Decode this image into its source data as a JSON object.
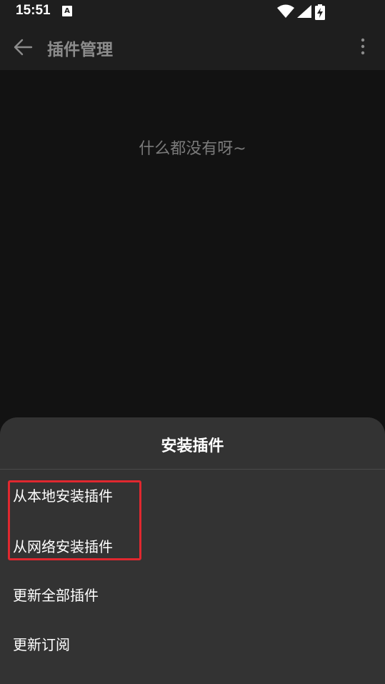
{
  "status_bar": {
    "time": "15:51",
    "notification_icon_letter": "A",
    "icons": [
      "wifi-icon",
      "signal-icon",
      "battery-charging-icon"
    ]
  },
  "app_bar": {
    "title": "插件管理",
    "back_icon": "arrow-left-icon",
    "more_icon": "more-vert-icon"
  },
  "main": {
    "empty_text": "什么都没有呀~"
  },
  "sheet": {
    "title": "安装插件",
    "items": [
      {
        "label": "从本地安装插件"
      },
      {
        "label": "从网络安装插件"
      },
      {
        "label": "更新全部插件"
      },
      {
        "label": "更新订阅"
      }
    ],
    "highlight_color": "#e0282f"
  },
  "colors": {
    "background": "#121212",
    "app_bar": "#1e1e1e",
    "sheet": "#333333",
    "title_text": "#8c8c8c"
  }
}
